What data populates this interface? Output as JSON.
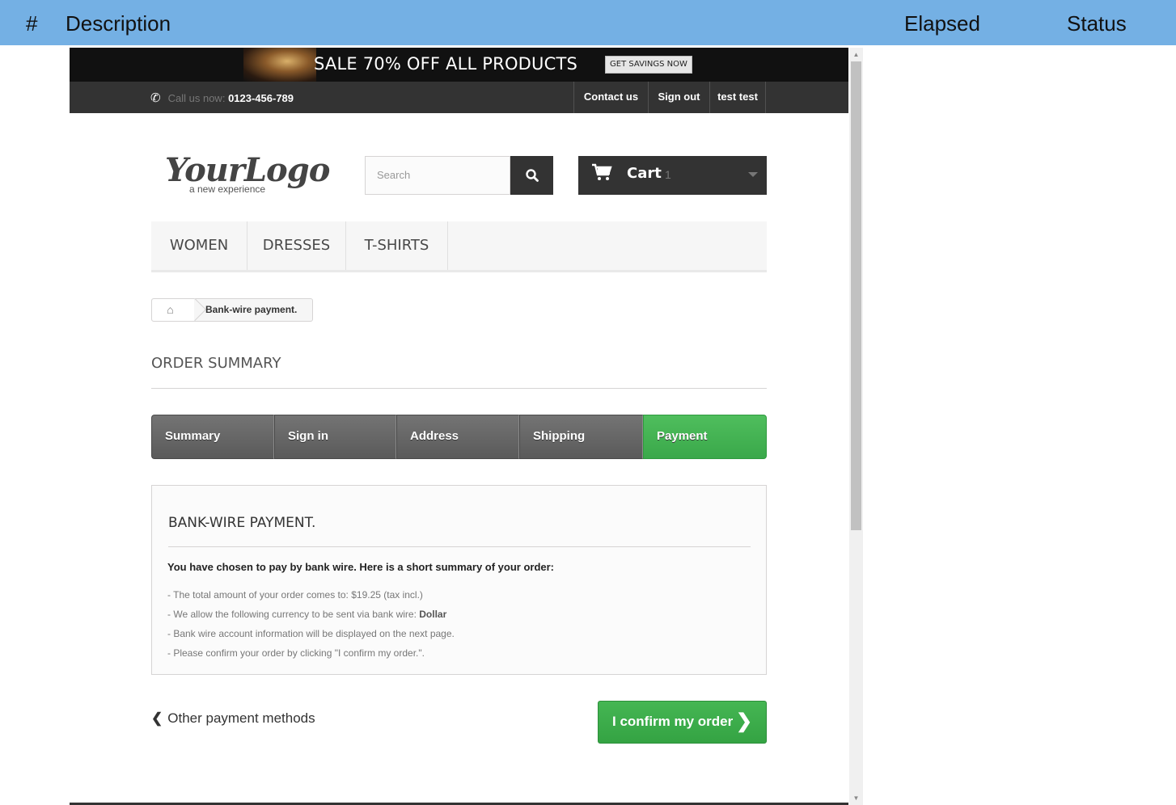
{
  "report": {
    "col_hash": "#",
    "col_description": "Description",
    "col_elapsed": "Elapsed",
    "col_status": "Status"
  },
  "banner": {
    "text": "SALE 70% OFF ALL PRODUCTS",
    "button": "GET SAVINGS NOW"
  },
  "topnav": {
    "call_prefix": "Call us now:",
    "phone": "0123-456-789",
    "contact": "Contact us",
    "signout": "Sign out",
    "user": "test test"
  },
  "logo": {
    "main": "YourLogo",
    "tagline": "a new experience"
  },
  "search": {
    "placeholder": "Search"
  },
  "cart": {
    "label": "Cart",
    "count": "1"
  },
  "menu": {
    "items": [
      "WOMEN",
      "DRESSES",
      "T-SHIRTS"
    ]
  },
  "breadcrumb": {
    "current": "Bank-wire payment."
  },
  "page": {
    "heading": "ORDER SUMMARY"
  },
  "steps": [
    "Summary",
    "Sign in",
    "Address",
    "Shipping",
    "Payment"
  ],
  "payment": {
    "title": "BANK-WIRE PAYMENT.",
    "lead": "You have chosen to pay by bank wire. Here is a short summary of your order:",
    "line1": "- The total amount of your order comes to: $19.25 (tax incl.)",
    "line2_prefix": "- We allow the following currency to be sent via bank wire: ",
    "line2_currency": "Dollar",
    "line3": "- Bank wire account information will be displayed on the next page.",
    "line4": "- Please confirm your order by clicking \"I confirm my order.\"."
  },
  "actions": {
    "back": "Other payment methods",
    "confirm": "I confirm my order"
  },
  "colors": {
    "header_blue": "#74b0e4",
    "step_active": "#45b653",
    "dark": "#333333"
  }
}
